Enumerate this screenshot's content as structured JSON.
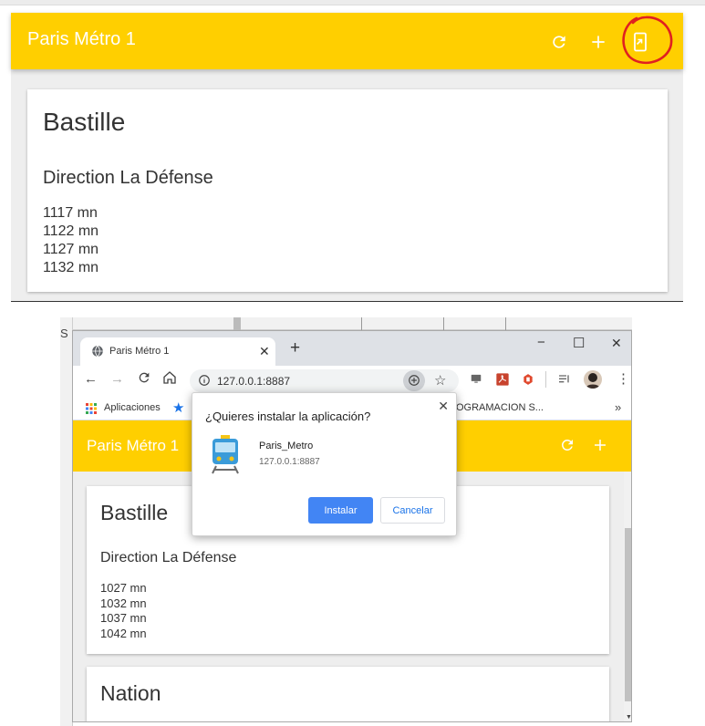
{
  "top_panel": {
    "app_title": "Paris Métro 1",
    "card": {
      "station": "Bastille",
      "direction": "Direction La Défense",
      "times": [
        "1117 mn",
        "1122 mn",
        "1127 mn",
        "1132 mn"
      ]
    },
    "icons": [
      "refresh-icon",
      "add-icon",
      "install-app-icon"
    ],
    "highlight_color": "#e02020"
  },
  "browser": {
    "side_fragment": "S",
    "tab_title": "Paris Métro 1",
    "new_tab_symbol": "+",
    "window_controls": [
      "−",
      "☐",
      "✕"
    ],
    "url": "127.0.0.1:8887",
    "bookmarks": {
      "apps_label": "Aplicaciones",
      "truncated_label": "OGRAMACION S...",
      "overflow": "»"
    },
    "app": {
      "title": "Paris Métro 1",
      "cards": [
        {
          "station": "Bastille",
          "direction": "Direction La Défense",
          "times": [
            "1027 mn",
            "1032 mn",
            "1037 mn",
            "1042 mn"
          ]
        },
        {
          "station": "Nation"
        }
      ]
    },
    "install_dialog": {
      "question": "¿Quieres instalar la aplicación?",
      "close_symbol": "✕",
      "app_name": "Paris_Metro",
      "origin": "127.0.0.1:8887",
      "install_label": "Instalar",
      "cancel_label": "Cancelar"
    }
  },
  "colors": {
    "header_yellow": "#ffcf00",
    "install_button_blue": "#4285f4",
    "cancel_text_blue": "#1a73e8"
  }
}
